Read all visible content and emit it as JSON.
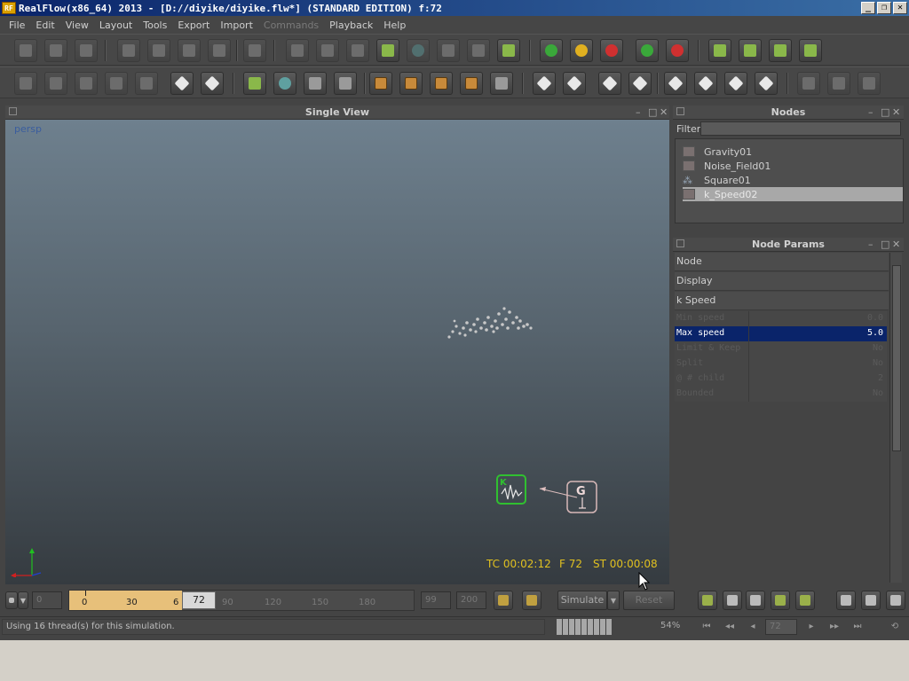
{
  "window": {
    "title": "RealFlow(x86_64) 2013 - [D://diyike/diyike.flw*] (STANDARD EDITION) f:72",
    "icon_label": "RF"
  },
  "menu": [
    "File",
    "Edit",
    "View",
    "Layout",
    "Tools",
    "Export",
    "Import",
    "Commands",
    "Playback",
    "Help"
  ],
  "viewport": {
    "title": "Single View",
    "camera_label": "persp",
    "tc": "TC 00:02:12",
    "frame": "F 72",
    "st": "ST 00:00:08"
  },
  "nodes_panel": {
    "title": "Nodes",
    "filter_label": "Filter",
    "filter_value": "",
    "items": [
      {
        "label": "Gravity01",
        "icon": "daemon-icon"
      },
      {
        "label": "Noise_Field01",
        "icon": "daemon-icon"
      },
      {
        "label": "Square01",
        "icon": "emitter-icon"
      },
      {
        "label": "k_Speed02",
        "icon": "daemon-icon",
        "selected": true
      }
    ]
  },
  "node_params": {
    "title": "Node Params",
    "sections": [
      "Node",
      "Display",
      "k Speed"
    ],
    "params": [
      {
        "name": "Min speed",
        "value": "0.0"
      },
      {
        "name": "Max speed",
        "value": "5.0",
        "active": true
      },
      {
        "name": "Limit & Keep",
        "value": "No"
      },
      {
        "name": "Split",
        "value": "No"
      },
      {
        "name": "@ # child",
        "value": "2"
      },
      {
        "name": "Bounded",
        "value": "No"
      }
    ]
  },
  "timeline": {
    "start": "0",
    "ticks": [
      "0",
      "30",
      "6",
      "90",
      "120",
      "150",
      "180"
    ],
    "current_frame": "72",
    "end_a": "99",
    "end_b": "200",
    "simulate_label": "Simulate",
    "reset_label": "Reset"
  },
  "status": {
    "message": "Using 16 thread(s) for this simulation.",
    "percent": "54%",
    "frame_input": "72"
  },
  "colors": {
    "overlay_text": "#e0c020",
    "selected_param": "#0a246a",
    "timeline_fill": "#e7c07a"
  }
}
